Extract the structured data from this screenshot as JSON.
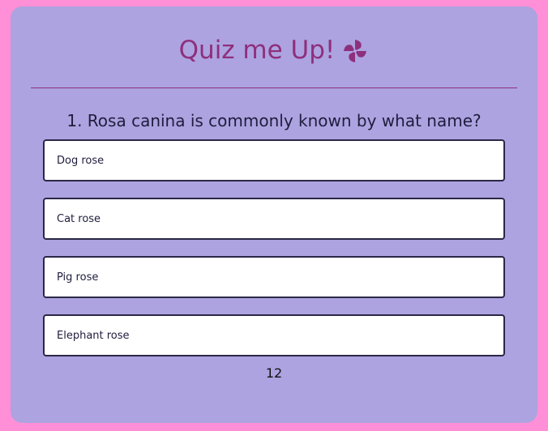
{
  "header": {
    "title": "Quiz me Up!",
    "icon": "pinwheel-icon",
    "title_color": "#8e2f7c"
  },
  "colors": {
    "page_background": "#ff8fd6",
    "card_background": "#ada3e0",
    "answer_background": "#ffffff",
    "answer_border": "#2a2746"
  },
  "quiz": {
    "question": "1. Rosa canina is commonly known by what name?",
    "answers": [
      {
        "label": "Dog rose"
      },
      {
        "label": "Cat rose"
      },
      {
        "label": "Pig rose"
      },
      {
        "label": "Elephant rose"
      }
    ],
    "timer": "12"
  }
}
